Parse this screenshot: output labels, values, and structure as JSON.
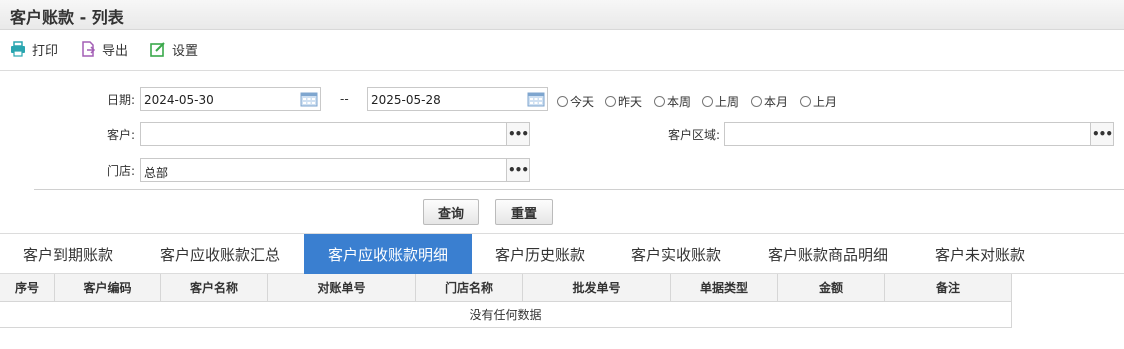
{
  "page": {
    "title": "客户账款 - 列表"
  },
  "toolbar": {
    "print": "打印",
    "export": "导出",
    "settings": "设置"
  },
  "filters": {
    "date_label": "日期:",
    "date_from": "2024-05-30",
    "date_sep": "--",
    "date_to": "2025-05-28",
    "quick_ranges": [
      "今天",
      "昨天",
      "本周",
      "上周",
      "本月",
      "上月"
    ],
    "customer_label": "客户:",
    "customer_value": "",
    "region_label": "客户区域:",
    "region_value": "",
    "store_label": "门店:",
    "store_value": "总部",
    "more_glyph": "•••"
  },
  "actions": {
    "query": "查询",
    "reset": "重置"
  },
  "tabs": {
    "items": [
      "客户到期账款",
      "客户应收账款汇总",
      "客户应收账款明细",
      "客户历史账款",
      "客户实收账款",
      "客户账款商品明细",
      "客户未对账款"
    ],
    "active_index": 2
  },
  "table": {
    "columns": [
      "序号",
      "客户编码",
      "客户名称",
      "对账单号",
      "门店名称",
      "批发单号",
      "单据类型",
      "金额",
      "备注"
    ],
    "empty_text": "没有任何数据"
  },
  "colors": {
    "accent": "#3a7fd0",
    "print_icon": "#2aa6b0",
    "export_icon": "#a35fb5",
    "settings_icon": "#3aa84b"
  }
}
